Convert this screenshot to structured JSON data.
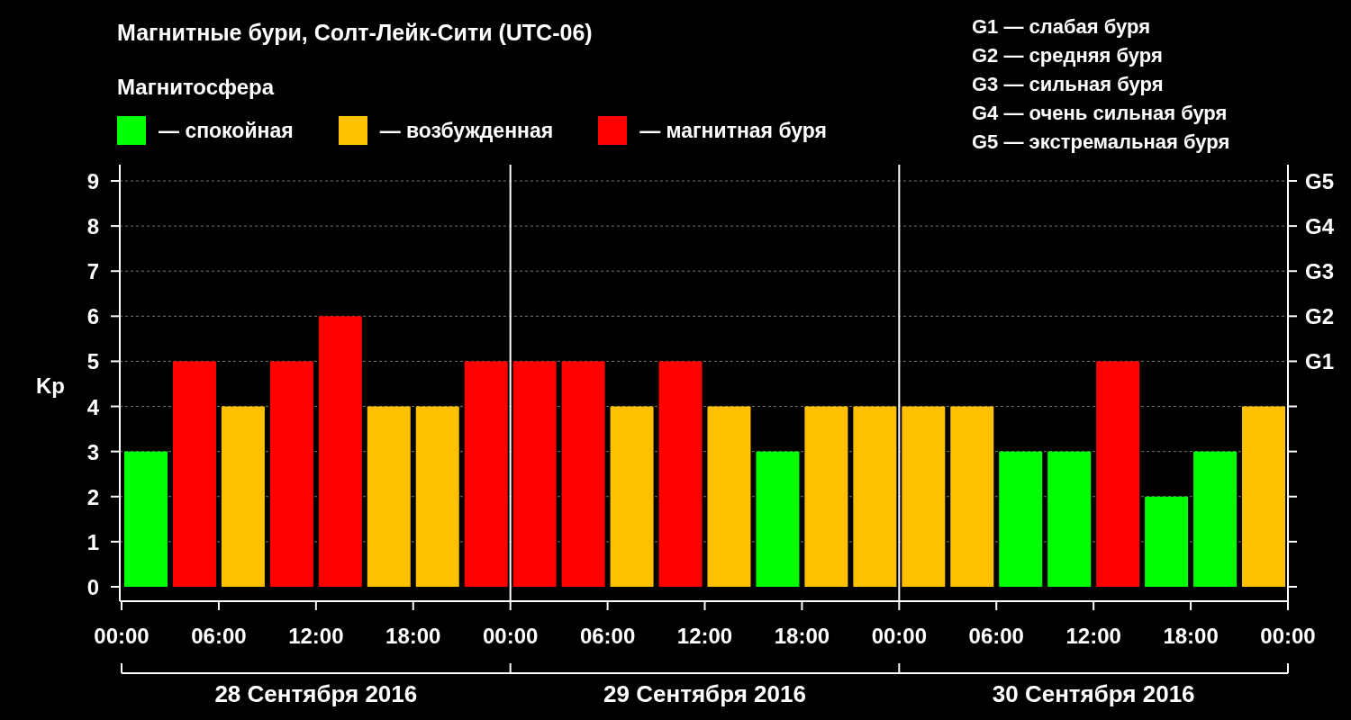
{
  "title": "Магнитные бури, Солт-Лейк-Сити (UTC-06)",
  "legend": {
    "title": "Магнитосфера",
    "dash": "—"
  },
  "scale": [
    "G1 — слабая буря",
    "G2 — средняя буря",
    "G3 — сильная буря",
    "G4 — очень сильная буря",
    "G5 — экстремальная буря"
  ],
  "chart": {
    "dates": [
      "28 Сентября 2016",
      "29 Сентября 2016",
      "30 Сентября 2016"
    ],
    "chart_data": {
      "type": "bar",
      "ylabel": "Kp",
      "grid": true,
      "x": [
        "2016-09-28T01:30",
        "2016-09-28T04:30",
        "2016-09-28T07:30",
        "2016-09-28T10:30",
        "2016-09-28T13:30",
        "2016-09-28T16:30",
        "2016-09-28T19:30",
        "2016-09-28T22:30",
        "2016-09-29T01:30",
        "2016-09-29T04:30",
        "2016-09-29T07:30",
        "2016-09-29T10:30",
        "2016-09-29T13:30",
        "2016-09-29T16:30",
        "2016-09-29T19:30",
        "2016-09-29T22:30",
        "2016-09-30T01:30",
        "2016-09-30T04:30",
        "2016-09-30T07:30",
        "2016-09-30T10:30",
        "2016-09-30T13:30",
        "2016-09-30T16:30",
        "2016-09-30T19:30",
        "2016-09-30T22:30"
      ],
      "series": [
        {
          "name": "спокойная",
          "color": "#00ff00",
          "values": [
            3,
            null,
            null,
            null,
            null,
            null,
            null,
            null,
            null,
            null,
            null,
            null,
            null,
            3,
            null,
            null,
            null,
            null,
            3,
            3,
            null,
            2,
            3,
            null
          ]
        },
        {
          "name": "возбужденная",
          "color": "#ffc000",
          "values": [
            null,
            null,
            4,
            null,
            null,
            4,
            4,
            null,
            null,
            null,
            4,
            null,
            4,
            null,
            4,
            4,
            4,
            4,
            null,
            null,
            null,
            null,
            null,
            4
          ]
        },
        {
          "name": "магнитная буря",
          "color": "#ff0000",
          "values": [
            null,
            5,
            null,
            5,
            6,
            null,
            null,
            5,
            5,
            5,
            null,
            5,
            null,
            null,
            null,
            null,
            null,
            null,
            null,
            null,
            5,
            null,
            null,
            null
          ]
        }
      ],
      "xlim": [
        "2016-09-28T00:00",
        "2016-10-01T00:00"
      ],
      "ylim": [
        -0.32,
        9.36
      ],
      "xticks": [
        {
          "value": "2016-09-28T00:00",
          "label": "00:00"
        },
        {
          "value": "2016-09-28T06:00",
          "label": "06:00"
        },
        {
          "value": "2016-09-28T12:00",
          "label": "12:00"
        },
        {
          "value": "2016-09-28T18:00",
          "label": "18:00"
        },
        {
          "value": "2016-09-29T00:00",
          "label": "00:00"
        },
        {
          "value": "2016-09-29T06:00",
          "label": "06:00"
        },
        {
          "value": "2016-09-29T12:00",
          "label": "12:00"
        },
        {
          "value": "2016-09-29T18:00",
          "label": "18:00"
        },
        {
          "value": "2016-09-30T00:00",
          "label": "00:00"
        },
        {
          "value": "2016-09-30T06:00",
          "label": "06:00"
        },
        {
          "value": "2016-09-30T12:00",
          "label": "12:00"
        },
        {
          "value": "2016-09-30T18:00",
          "label": "18:00"
        },
        {
          "value": "2016-10-01T00:00",
          "label": "00:00"
        }
      ],
      "yticks": [
        0,
        1,
        2,
        3,
        4,
        5,
        6,
        7,
        8,
        9
      ],
      "annotations": [
        "G1",
        "G2",
        "G3",
        "G4",
        "G5"
      ]
    }
  }
}
